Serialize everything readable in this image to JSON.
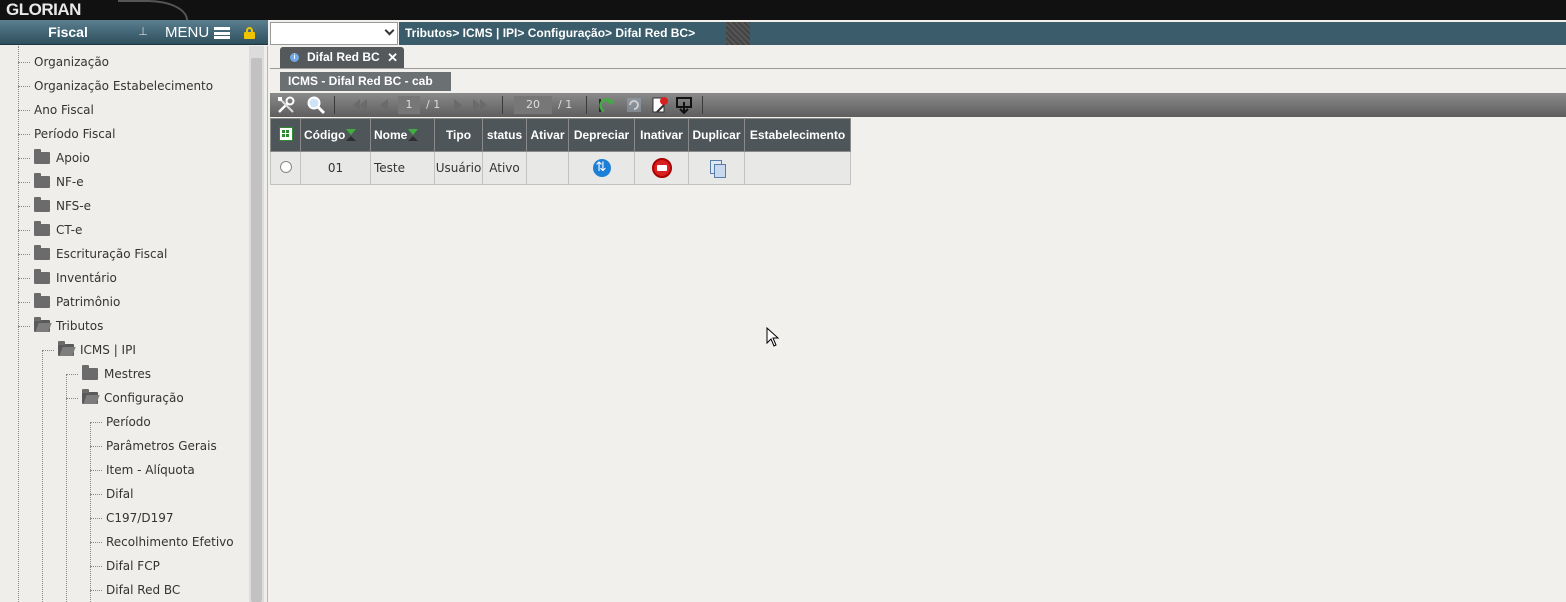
{
  "app": {
    "logo": "GLORIAN"
  },
  "left_header": {
    "module": "Fiscal",
    "menu_label": "MENU"
  },
  "sidebar": {
    "items": [
      {
        "label": "Organização",
        "level": 0,
        "type": "leaf"
      },
      {
        "label": "Organização Estabelecimento",
        "level": 0,
        "type": "leaf"
      },
      {
        "label": "Ano Fiscal",
        "level": 0,
        "type": "leaf"
      },
      {
        "label": "Período Fiscal",
        "level": 0,
        "type": "leaf"
      },
      {
        "label": "Apoio",
        "level": 0,
        "type": "folder"
      },
      {
        "label": "NF-e",
        "level": 0,
        "type": "folder"
      },
      {
        "label": "NFS-e",
        "level": 0,
        "type": "folder"
      },
      {
        "label": "CT-e",
        "level": 0,
        "type": "folder"
      },
      {
        "label": "Escrituração Fiscal",
        "level": 0,
        "type": "folder"
      },
      {
        "label": "Inventário",
        "level": 0,
        "type": "folder"
      },
      {
        "label": "Patrimônio",
        "level": 0,
        "type": "folder"
      },
      {
        "label": "Tributos",
        "level": 0,
        "type": "folder-open"
      },
      {
        "label": "ICMS | IPI",
        "level": 1,
        "type": "folder-open"
      },
      {
        "label": "Mestres",
        "level": 2,
        "type": "folder"
      },
      {
        "label": "Configuração",
        "level": 2,
        "type": "folder-open"
      },
      {
        "label": "Período",
        "level": 3,
        "type": "leaf"
      },
      {
        "label": "Parâmetros Gerais",
        "level": 3,
        "type": "leaf"
      },
      {
        "label": "Item - Alíquota",
        "level": 3,
        "type": "leaf"
      },
      {
        "label": "Difal",
        "level": 3,
        "type": "leaf"
      },
      {
        "label": "C197/D197",
        "level": 3,
        "type": "leaf"
      },
      {
        "label": "Recolhimento Efetivo",
        "level": 3,
        "type": "leaf"
      },
      {
        "label": "Difal FCP",
        "level": 3,
        "type": "leaf"
      },
      {
        "label": "Difal Red BC",
        "level": 3,
        "type": "leaf"
      }
    ]
  },
  "breadcrumb": "Tributos> ICMS | IPI> Configuração> Difal Red BC>",
  "tab": {
    "label": "Difal Red BC",
    "close": "✕"
  },
  "subtab": {
    "label": "ICMS - Difal Red BC - cab"
  },
  "toolbar": {
    "page_current": "1",
    "page_total": "/ 1",
    "page_size": "20",
    "page_size_total": "/ 1"
  },
  "grid": {
    "columns": [
      "Código",
      "Nome",
      "Tipo",
      "status",
      "Ativar",
      "Depreciar",
      "Inativar",
      "Duplicar",
      "Estabelecimento"
    ],
    "rows": [
      {
        "codigo": "01",
        "nome": "Teste",
        "tipo": "Usuário",
        "status": "Ativo",
        "ativar": "",
        "estabelecimento": ""
      }
    ]
  },
  "colors": {
    "breadcrumb_bg": "#3b5d6b",
    "header_bg": "#4f5659",
    "accent_blue": "#1e7fd6",
    "accent_red": "#d92020",
    "lock": "#f0c400"
  }
}
